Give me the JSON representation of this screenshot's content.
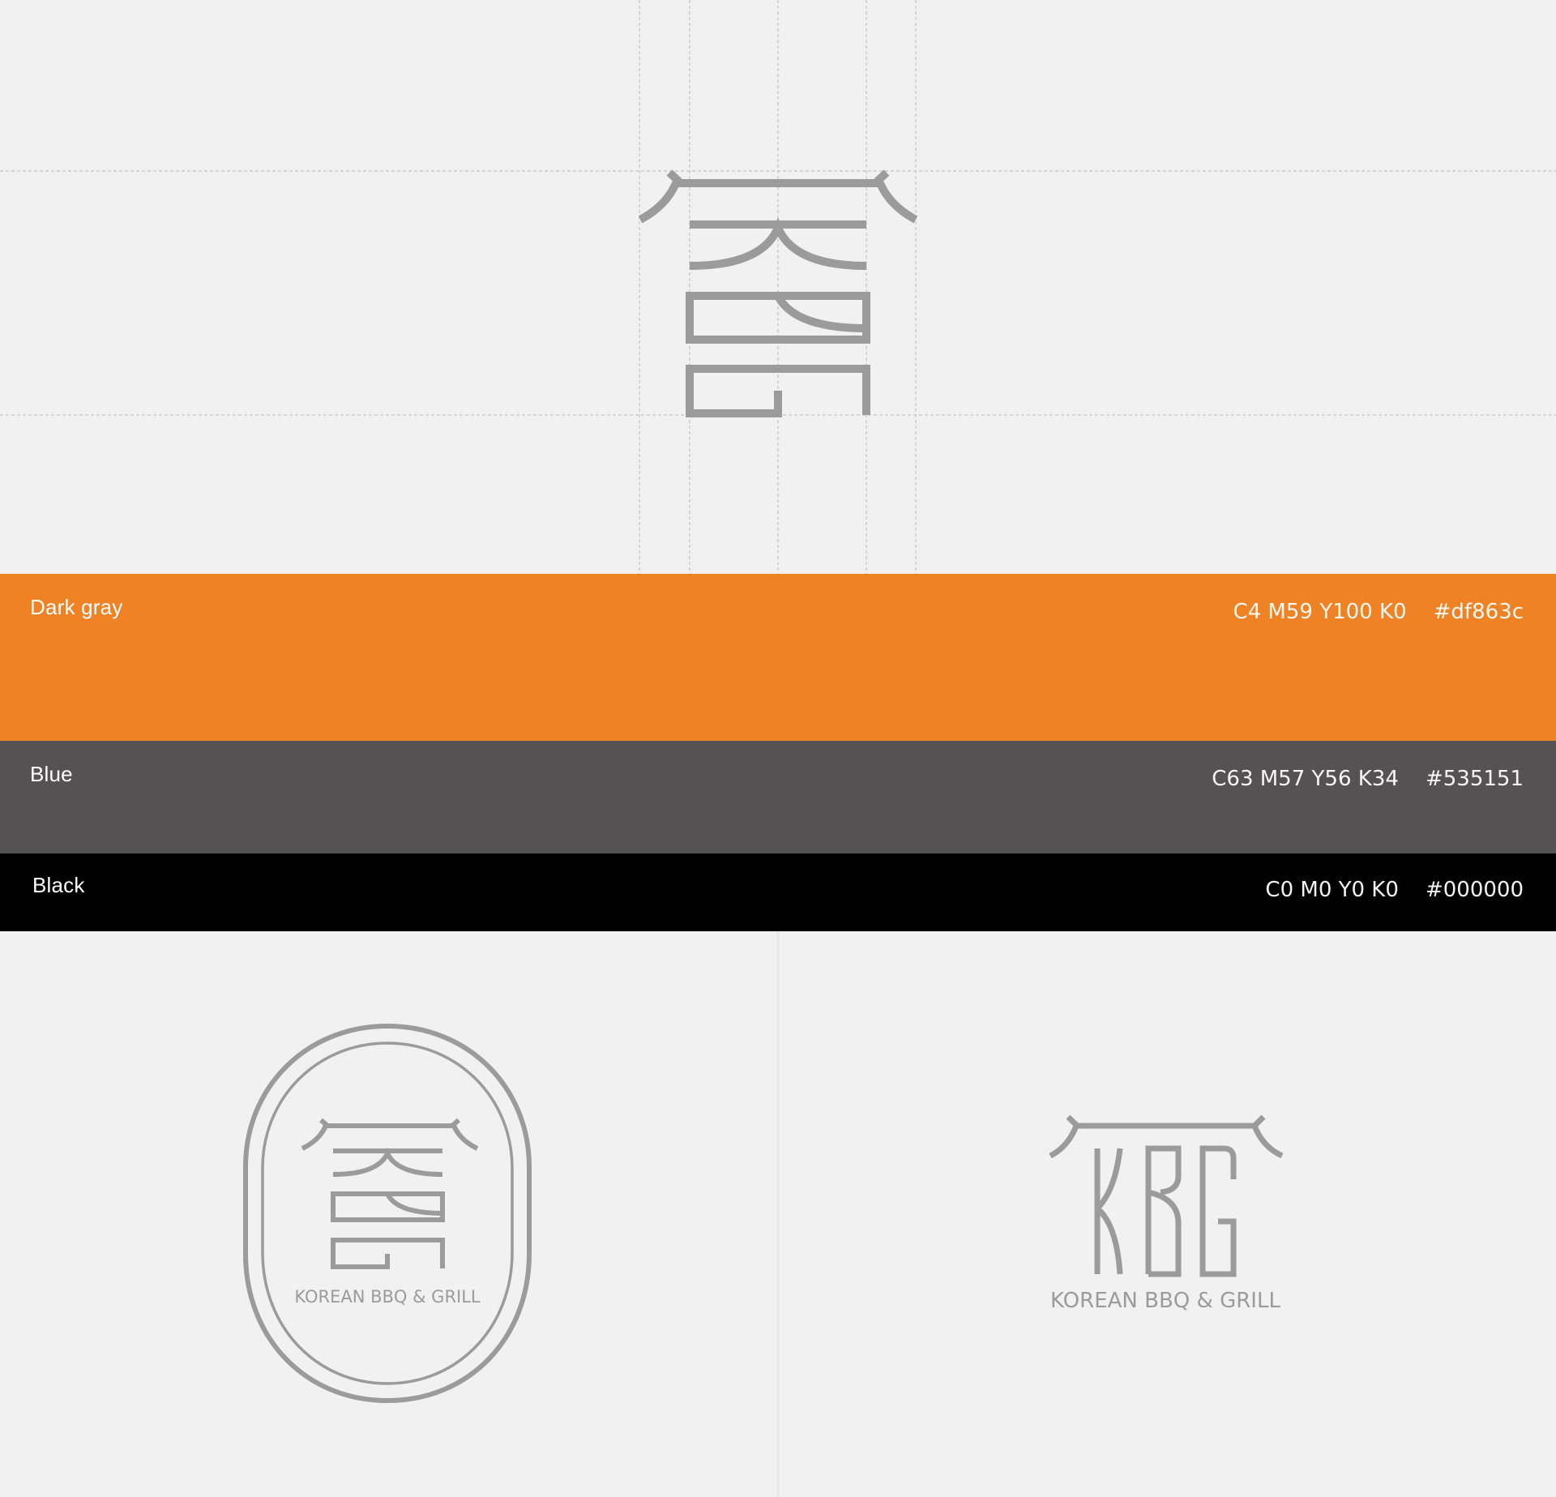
{
  "colors": {
    "background": "#f1f1f1",
    "logo_gray": "#9b9b9b",
    "guide_line": "#bdbdbd"
  },
  "icons": {
    "grid_logo": "kbg-monogram-icon",
    "badge_logo": "kbg-badge-logo",
    "wordmark_logo": "kbg-wordmark-logo"
  },
  "swatches": [
    {
      "name": "Dark gray",
      "spec": "C4 M59 Y100 K0    #df863c",
      "color": "#ee8224"
    },
    {
      "name": "Blue",
      "spec": "C63 M57 Y56 K34    #535151",
      "color": "#545253"
    },
    {
      "name": "Black",
      "spec": "C0 M0 Y0 K0    #000000",
      "color": "#000000"
    }
  ],
  "badge": {
    "tagline": "KOREAN BBQ & GRILL"
  },
  "wordmark": {
    "letters": "KBG",
    "tagline": "KOREAN BBQ & GRILL"
  }
}
